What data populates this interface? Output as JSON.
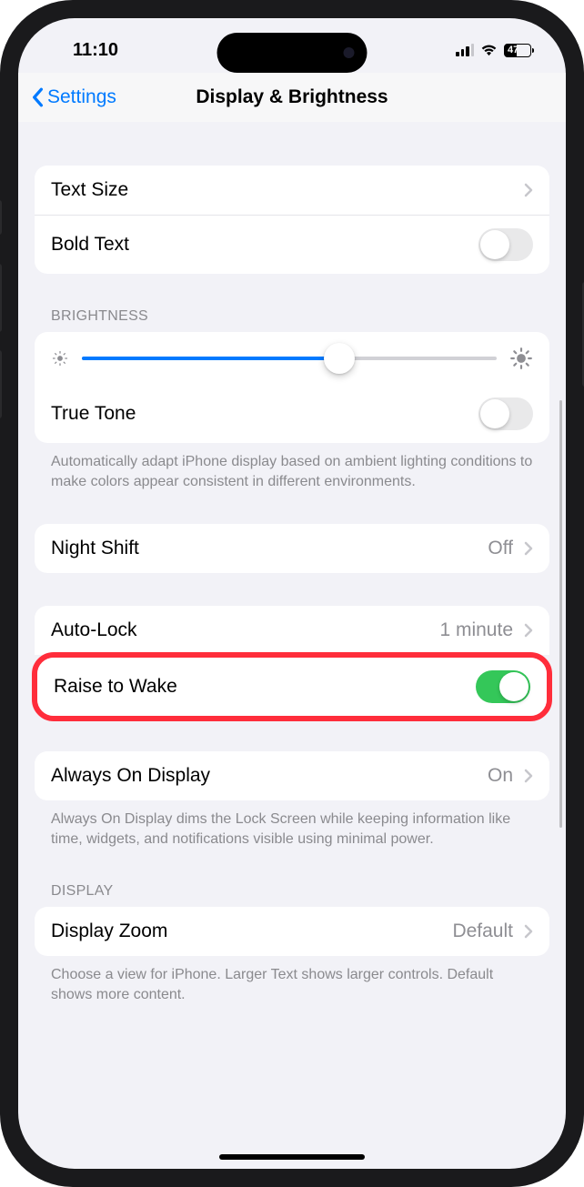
{
  "status": {
    "time": "11:10",
    "battery": "47"
  },
  "nav": {
    "back": "Settings",
    "title": "Display & Brightness"
  },
  "rows": {
    "textSize": "Text Size",
    "boldText": "Bold Text",
    "trueTone": "True Tone",
    "nightShift": "Night Shift",
    "nightShiftValue": "Off",
    "autoLock": "Auto-Lock",
    "autoLockValue": "1 minute",
    "raiseToWake": "Raise to Wake",
    "alwaysOn": "Always On Display",
    "alwaysOnValue": "On",
    "displayZoom": "Display Zoom",
    "displayZoomValue": "Default"
  },
  "sections": {
    "brightness": "BRIGHTNESS",
    "display": "DISPLAY"
  },
  "footers": {
    "trueTone": "Automatically adapt iPhone display based on ambient lighting conditions to make colors appear consistent in different environments.",
    "alwaysOn": "Always On Display dims the Lock Screen while keeping information like time, widgets, and notifications visible using minimal power.",
    "displayZoom": "Choose a view for iPhone. Larger Text shows larger controls. Default shows more content."
  },
  "toggles": {
    "boldText": false,
    "trueTone": false,
    "raiseToWake": true
  },
  "brightnessPercent": 62
}
